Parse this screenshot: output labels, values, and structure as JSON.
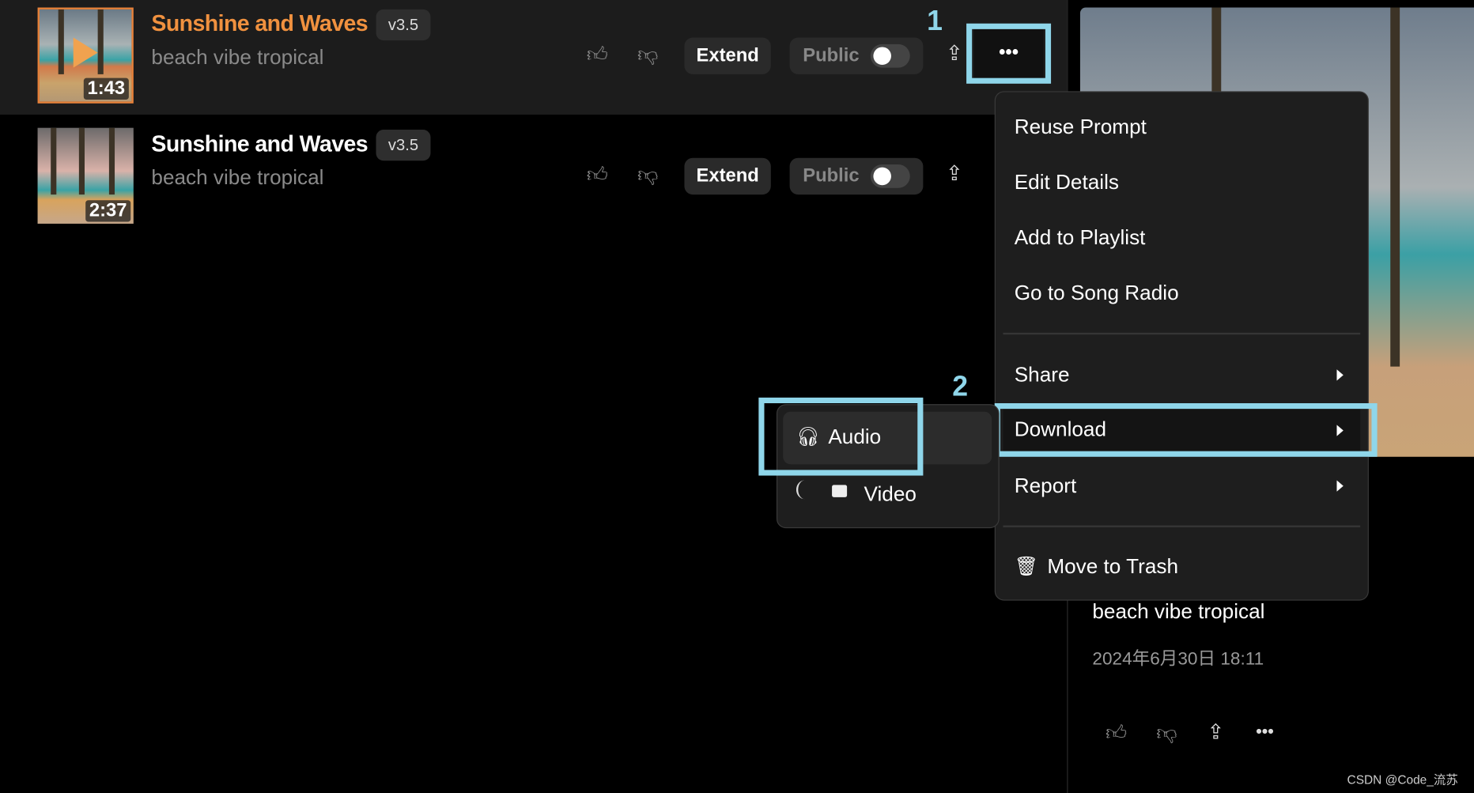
{
  "songs": [
    {
      "title": "Sunshine and Waves",
      "version": "v3.5",
      "tags": "beach vibe tropical",
      "duration": "1:43",
      "active": true
    },
    {
      "title": "Sunshine and Waves",
      "version": "v3.5",
      "tags": "beach vibe tropical",
      "duration": "2:37",
      "active": false
    }
  ],
  "row_actions": {
    "extend": "Extend",
    "public": "Public",
    "public_on": false
  },
  "annotations": {
    "step1": "1",
    "step2": "2"
  },
  "menu": {
    "items": [
      "Reuse Prompt",
      "Edit Details",
      "Add to Playlist",
      "Go to Song Radio"
    ],
    "share": "Share",
    "download": "Download",
    "report": "Report",
    "trash": "Move to Trash"
  },
  "download_submenu": {
    "audio": "Audio",
    "video": "Video"
  },
  "detail": {
    "tags": "beach vibe tropical",
    "date": "2024年6月30日 18:11"
  },
  "watermark": "CSDN @Code_流苏",
  "colors": {
    "accent": "#f0913f",
    "highlight": "#8fd6ea",
    "menu_bg": "#1e1e1e"
  }
}
